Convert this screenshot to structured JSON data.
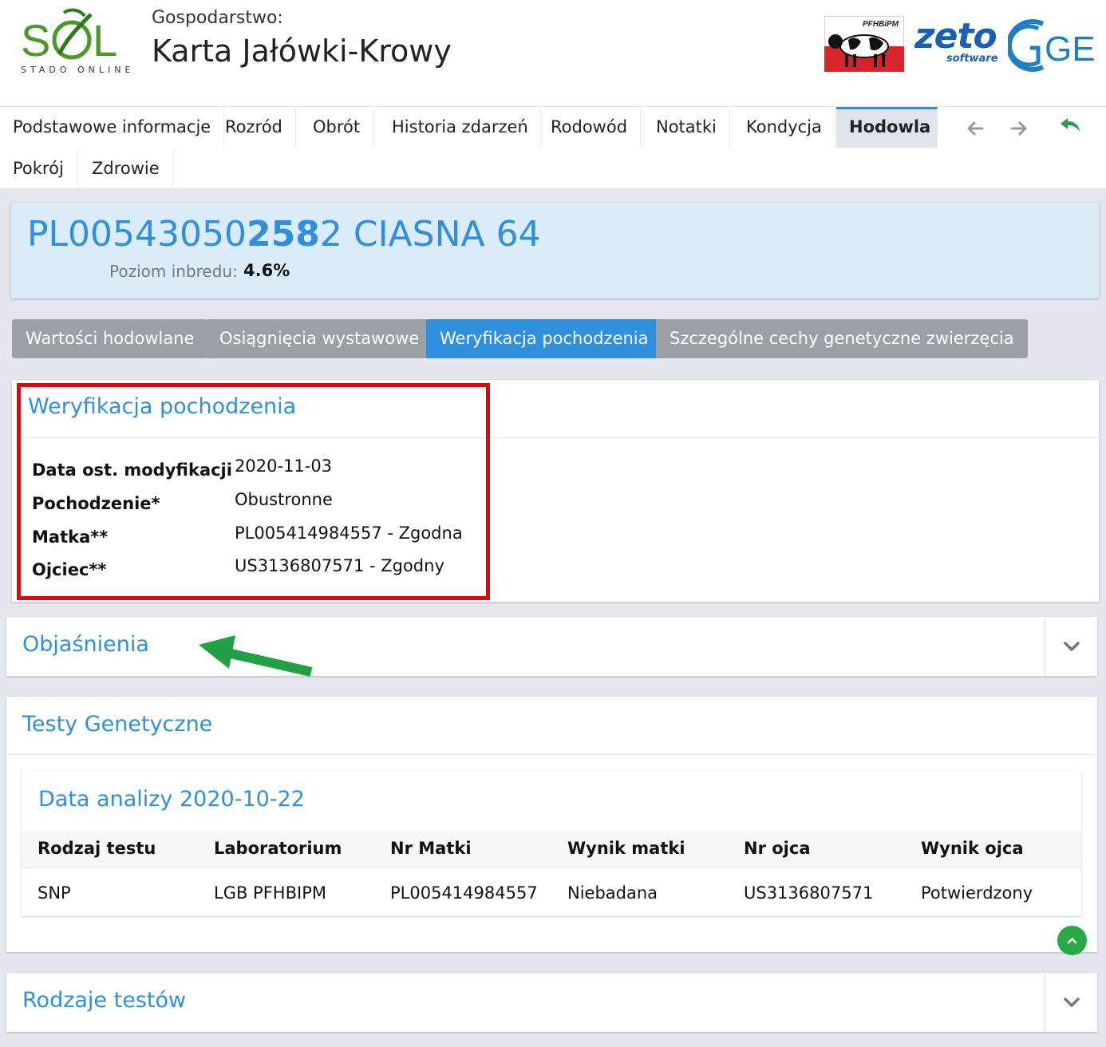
{
  "header": {
    "logo_sub": "STADO ONLINE",
    "farm_label": "Gospodarstwo:",
    "title": "Karta Jałówki-Krowy",
    "partner_pf_label": "PFHBiPM",
    "partner_zeto": "zeto",
    "partner_zeto_sub": "software",
    "partner_gen": "GEN"
  },
  "nav": {
    "tabs": [
      {
        "label": "Podstawowe informacje"
      },
      {
        "label": "Rozród"
      },
      {
        "label": "Obrót"
      },
      {
        "label": "Historia zdarzeń"
      },
      {
        "label": "Rodowód"
      },
      {
        "label": "Notatki"
      },
      {
        "label": "Kondycja"
      },
      {
        "label": "Hodowla"
      },
      {
        "label": "Pokrój"
      },
      {
        "label": "Zdrowie"
      }
    ],
    "active": "Hodowla",
    "icons": [
      "arrow-left-icon",
      "arrow-right-icon",
      "reply-icon"
    ]
  },
  "animal": {
    "id_prefix": "PL00543050",
    "id_bold": "258",
    "id_suffix": "2",
    "name": "CIASNA 64",
    "inbreeding_label": "Poziom inbredu:",
    "inbreeding_value": "4.6%"
  },
  "subtabs": [
    {
      "label": "Wartości hodowlane"
    },
    {
      "label": "Osiągnięcia wystawowe"
    },
    {
      "label": "Weryfikacja pochodzenia"
    },
    {
      "label": "Szczególne cechy genetyczne zwierzęcia"
    }
  ],
  "verification": {
    "title": "Weryfikacja pochodzenia",
    "fields": [
      {
        "label": "Data ost. modyfikacji",
        "value": "2020-11-03"
      },
      {
        "label": "Pochodzenie*",
        "value": "Obustronne"
      },
      {
        "label": "Matka**",
        "value": "PL005414984557 - Zgodna"
      },
      {
        "label": "Ojciec**",
        "value": "US3136807571 - Zgodny"
      }
    ]
  },
  "explanations": {
    "title": "Objaśnienia"
  },
  "genetic_tests": {
    "title": "Testy Genetyczne",
    "analysis_title": "Data analizy 2020-10-22",
    "columns": [
      "Rodzaj testu",
      "Laboratorium",
      "Nr Matki",
      "Wynik matki",
      "Nr ojca",
      "Wynik ojca"
    ],
    "rows": [
      [
        "SNP",
        "LGB PFHBIPM",
        "PL005414984557",
        "Niebadana",
        "US3136807571",
        "Potwierdzony"
      ]
    ]
  },
  "test_types": {
    "title": "Rodzaje testów"
  },
  "colors": {
    "accent": "#2f8fdc",
    "banner_bg": "#daebfa",
    "highlight": "#e8000b",
    "annotation_arrow": "#22a045",
    "scroll_top": "#2aa845"
  }
}
